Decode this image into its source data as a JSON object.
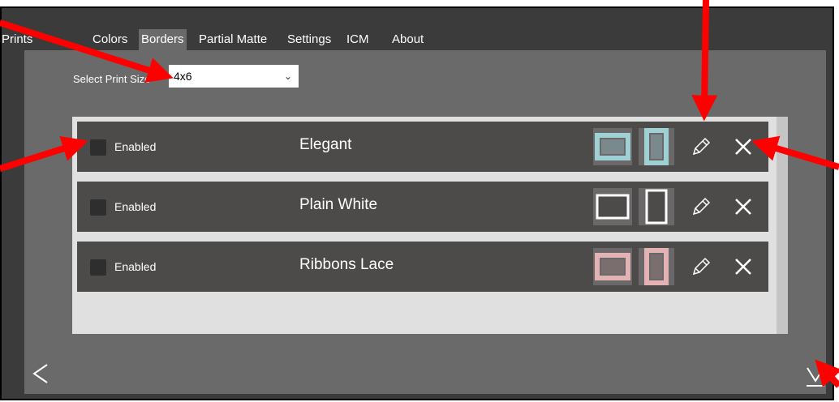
{
  "tabs": [
    {
      "label": "Prints",
      "active": false
    },
    {
      "label": "Colors",
      "active": false
    },
    {
      "label": "Borders",
      "active": true
    },
    {
      "label": "Partial Matte",
      "active": false
    },
    {
      "label": "Settings",
      "active": false
    },
    {
      "label": "ICM",
      "active": false
    },
    {
      "label": "About",
      "active": false
    }
  ],
  "print_size": {
    "label": "Select Print Size",
    "value": "4x6"
  },
  "borders": [
    {
      "enabled_label": "Enabled",
      "enabled": false,
      "name": "Elegant",
      "frame_color": "#9fd0d4"
    },
    {
      "enabled_label": "Enabled",
      "enabled": false,
      "name": "Plain White",
      "frame_color": "#ffffff"
    },
    {
      "enabled_label": "Enabled",
      "enabled": false,
      "name": "Ribbons Lace",
      "frame_color": "#e3b3b3"
    }
  ],
  "icons": {
    "edit": "pencil-icon",
    "delete": "close-icon",
    "back": "chevron-left-icon",
    "download": "download-icon"
  },
  "colors": {
    "annotation_arrow": "#ff0000",
    "app_bg": "#3b3b3b",
    "panel_bg": "#6a6a6a",
    "row_bg": "#4d4a4a"
  }
}
